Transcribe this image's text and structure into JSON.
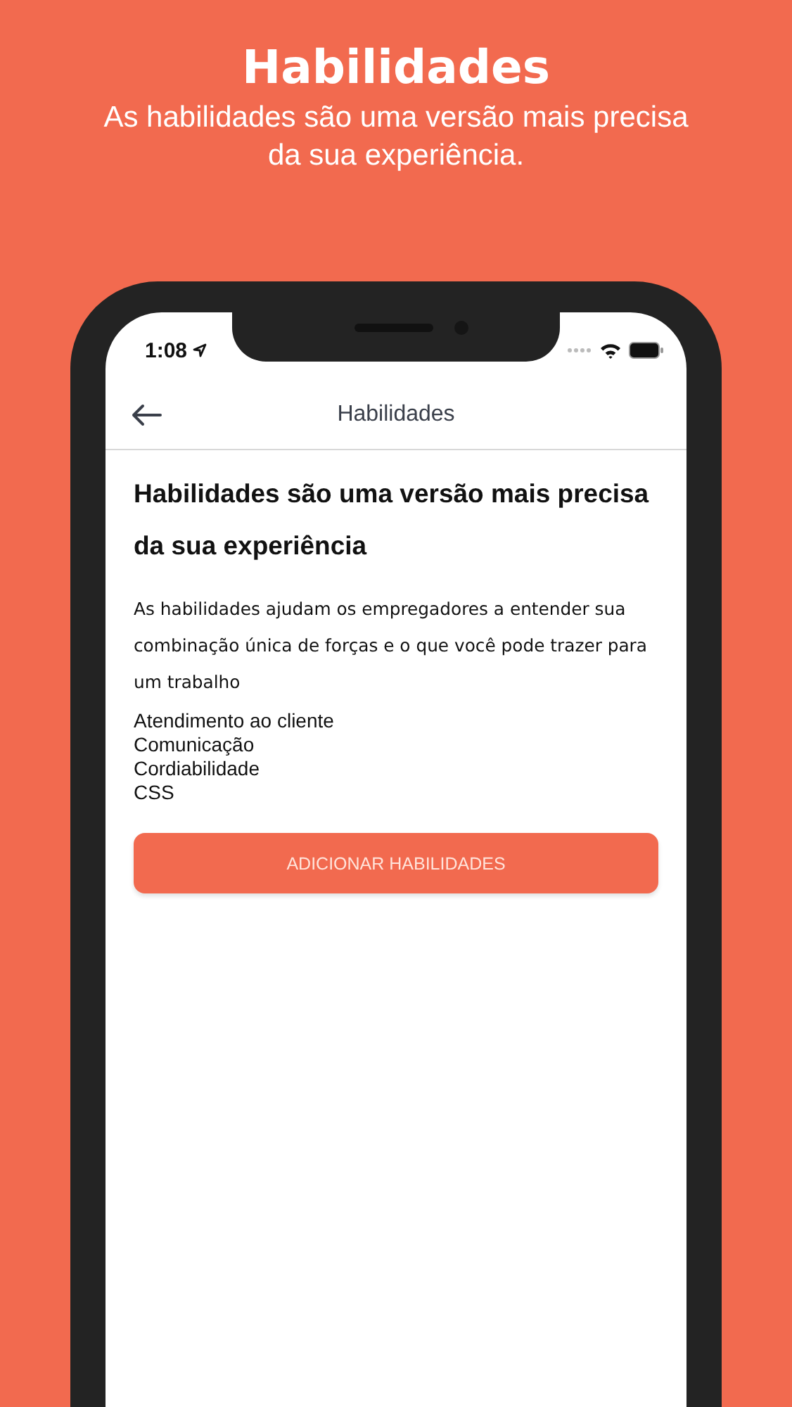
{
  "header": {
    "title": "Habilidades",
    "subtitle": "As habilidades são uma versão mais precisa da sua experiência."
  },
  "status_bar": {
    "time": "1:08"
  },
  "nav": {
    "title": "Habilidades"
  },
  "content": {
    "heading": "Habilidades são uma versão mais precisa da sua experiência",
    "description": "As habilidades ajudam os empregadores a entender sua combinação única de forças e o que você pode trazer para um trabalho",
    "skills": [
      "Atendimento ao cliente",
      "Comunicação",
      "Cordiabilidade",
      "CSS"
    ]
  },
  "button": {
    "label": "ADICIONAR HABILIDADES"
  }
}
